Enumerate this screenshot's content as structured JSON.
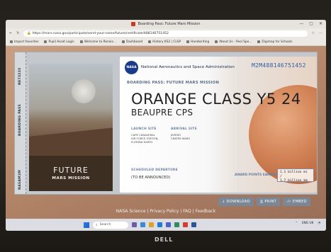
{
  "browser": {
    "tab_title": "Boarding Pass: Future Mars Mission",
    "url": "https://mars.nasa.gov/participate/send-your-name/future/certificate/488146751452",
    "window_controls": [
      "—",
      "▢",
      "✕"
    ],
    "favorites": [
      "Import favorites",
      "Pupil Asset Login",
      "Welcome to Renais...",
      "Dashboard",
      "History KS2 | CLSP",
      "Handwriting",
      "About Us - Pool Spe...",
      "Digimap for Schools"
    ]
  },
  "boarding_pass": {
    "stub_number": "NE73220",
    "stub_side_label": "BOARDING PASS",
    "stub_bottom_label": "NASAM2M",
    "stub_title": "FUTURE",
    "stub_subtitle": "MARS MISSION",
    "agency_logo": "NASA",
    "agency": "National Aeronautics and Space Administration",
    "pass_number": "M2M488146751452",
    "pass_label": "BOARDING PASS: FUTURE MARS MISSION",
    "name_line1": "ORANGE CLASS Y5 24",
    "name_line2": "BEAUPRE CPS",
    "launch_site_label": "LAUNCH SITE",
    "launch_site_value": "CAPE CANAVERAL AIR FORCE STATION, FLORIDA EARTH",
    "arrival_site_label": "ARRIVAL SITE",
    "arrival_site_value": "JEZERO CRATER MARS",
    "departure_label": "SCHEDULED DEPARTURE",
    "departure_value": "(TO BE ANNOUNCED)",
    "award_label": "AWARD POINTS EARNED",
    "award_line1": "1.1 billion mi /",
    "award_line2": "1.7 billion km"
  },
  "actions": {
    "download": "↓ DOWNLOAD",
    "print": "⎙ PRINT",
    "embed": "‹/› EMBED"
  },
  "footer": "NASA Science | Privacy Policy | FAQ | Feedback",
  "taskbar": {
    "search_placeholder": "Search",
    "lang": "ENG",
    "region": "UK"
  },
  "bezel_brand": "DELL",
  "colors": {
    "accent_blue": "#2a5ea8",
    "label_blue": "#6a7fa0",
    "mars_orange": "#d07b4a",
    "button_grey": "#7a8796"
  }
}
